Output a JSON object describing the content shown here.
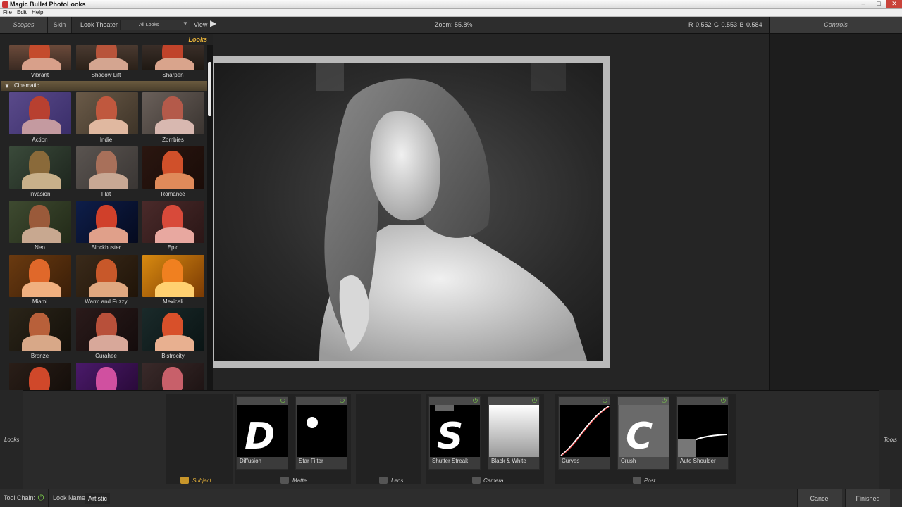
{
  "window": {
    "title": "Magic Bullet PhotoLooks"
  },
  "menu": [
    "File",
    "Edit",
    "Help"
  ],
  "topbar": {
    "scopes": "Scopes",
    "skin": "Skin",
    "look_theater": "Look Theater",
    "looks_select": "All Looks",
    "view": "View",
    "zoom": "Zoom:  55.8%",
    "rgb": "R 0.552   G 0.553   B 0.584",
    "controls": "Controls"
  },
  "looks_panel": {
    "header": "Looks",
    "category": "Cinematic",
    "top_row": [
      "Vibrant",
      "Shadow Lift",
      "Sharpen"
    ],
    "rows": [
      [
        "Action",
        "Indie",
        "Zombies"
      ],
      [
        "Invasion",
        "Flat",
        "Romance"
      ],
      [
        "Neo",
        "Blockbuster",
        "Epic"
      ],
      [
        "Miami",
        "Warm and Fuzzy",
        "Mexicali"
      ],
      [
        "Bronze",
        "Curahee",
        "Bistrocity"
      ]
    ]
  },
  "tools": {
    "left_label": "Looks",
    "right_label": "Tools",
    "groups": [
      "Subject",
      "Matte",
      "Lens",
      "Camera",
      "Post"
    ],
    "items": [
      "Diffusion",
      "Star Filter",
      "Shutter Streak",
      "Black & White",
      "Curves",
      "Crush",
      "Auto Shoulder"
    ],
    "letters": {
      "diffusion": "D",
      "shutter": "S",
      "crush": "C"
    }
  },
  "status": {
    "tool_chain": "Tool Chain:",
    "look_name_label": "Look Name:",
    "look_name_value": "Artistic",
    "cancel": "Cancel",
    "finished": "Finished"
  },
  "colors": {
    "accent": "#e8b33a",
    "power": "#7ccc4c"
  }
}
